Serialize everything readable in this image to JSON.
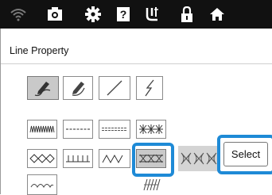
{
  "top_toolbar": {
    "icons": [
      "wifi-icon",
      "camera-icon",
      "gear-icon",
      "help-icon",
      "needle-thread-icon",
      "lock-icon",
      "home-icon"
    ]
  },
  "panel": {
    "title": "Line Property"
  },
  "tools": {
    "icons": [
      "pen-fill-icon",
      "pen-outline-icon",
      "straight-line-icon",
      "zigzag-line-icon"
    ],
    "selected": "pen-fill-icon"
  },
  "stitches": {
    "row1": [
      "zigzag-dense-stitch",
      "dashed-stitch",
      "double-dashed-stitch",
      "cross-stitch"
    ],
    "row2": [
      "diamond-stitch",
      "blanket-stitch",
      "wave-stitch",
      "fill-cross-stitch",
      "motif-stitch"
    ],
    "row3": [
      "scallop-stitch",
      "",
      "",
      "candlewick-stitch"
    ],
    "selected": "fill-cross-stitch"
  },
  "select_button": {
    "label": "Select"
  }
}
